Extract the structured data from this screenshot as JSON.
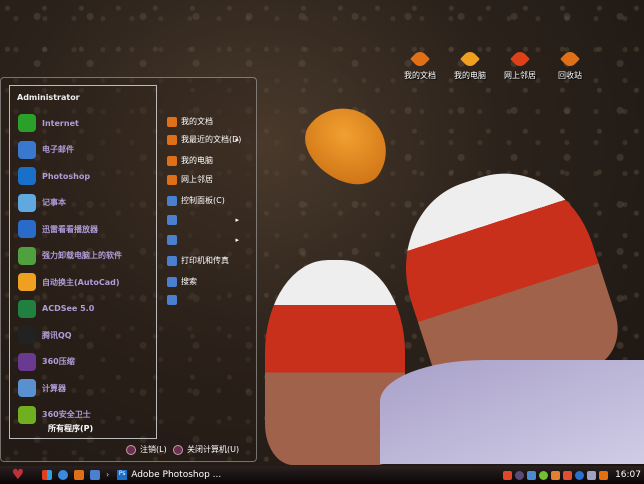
{
  "desktop": {
    "icons": [
      {
        "label": "我的文档"
      },
      {
        "label": "我的电脑"
      },
      {
        "label": "网上邻居"
      },
      {
        "label": "回收站"
      }
    ]
  },
  "start_menu": {
    "user": "Administrator",
    "programs": [
      {
        "label": "Internet",
        "icon": "ie-icon",
        "color": "#2aa02a"
      },
      {
        "label": "电子邮件",
        "icon": "mail-icon",
        "color": "#3a78d0"
      },
      {
        "label": "Photoshop",
        "icon": "photoshop-icon",
        "color": "#1a70c8"
      },
      {
        "label": "记事本",
        "icon": "notepad-icon",
        "color": "#60a8e0"
      },
      {
        "label": "迅雷看看播放器",
        "icon": "player-icon",
        "color": "#2a6ac8"
      },
      {
        "label": "强力卸载电脑上的软件",
        "icon": "uninstall-icon",
        "color": "#50a040"
      },
      {
        "label": "自动换主(AutoCad)",
        "icon": "auto-icon",
        "color": "#f0a020"
      },
      {
        "label": "ACDSee 5.0",
        "icon": "acdsee-icon",
        "color": "#208040"
      },
      {
        "label": "腾讯QQ",
        "icon": "qq-icon",
        "color": "#222"
      },
      {
        "label": "360压缩",
        "icon": "archive-icon",
        "color": "#6a3a90"
      },
      {
        "label": "计算器",
        "icon": "calculator-icon",
        "color": "#5a90d0"
      },
      {
        "label": "360安全卫士",
        "icon": "shield-icon",
        "color": "#70b020"
      }
    ],
    "all_programs": "所有程序(P)",
    "places": [
      {
        "label": "我的文档",
        "arrow": false
      },
      {
        "label": "我最近的文档(D)",
        "arrow": true
      },
      {
        "label": "我的电脑",
        "arrow": false
      },
      {
        "label": "网上邻居",
        "arrow": false
      },
      {
        "label": "控制面板(C)",
        "arrow": false
      },
      {
        "label": "",
        "arrow": true
      },
      {
        "label": "",
        "arrow": true
      },
      {
        "label": "打印机和传真",
        "arrow": false
      },
      {
        "label": "搜索",
        "arrow": false
      },
      {
        "label": "",
        "arrow": false
      }
    ],
    "logoff": "注销(L)",
    "shutdown": "关闭计算机(U)"
  },
  "taskbar": {
    "task": "Adobe Photoshop ...",
    "task_icon": "Ps",
    "clock": "16:07",
    "start_glyph": "♥"
  }
}
